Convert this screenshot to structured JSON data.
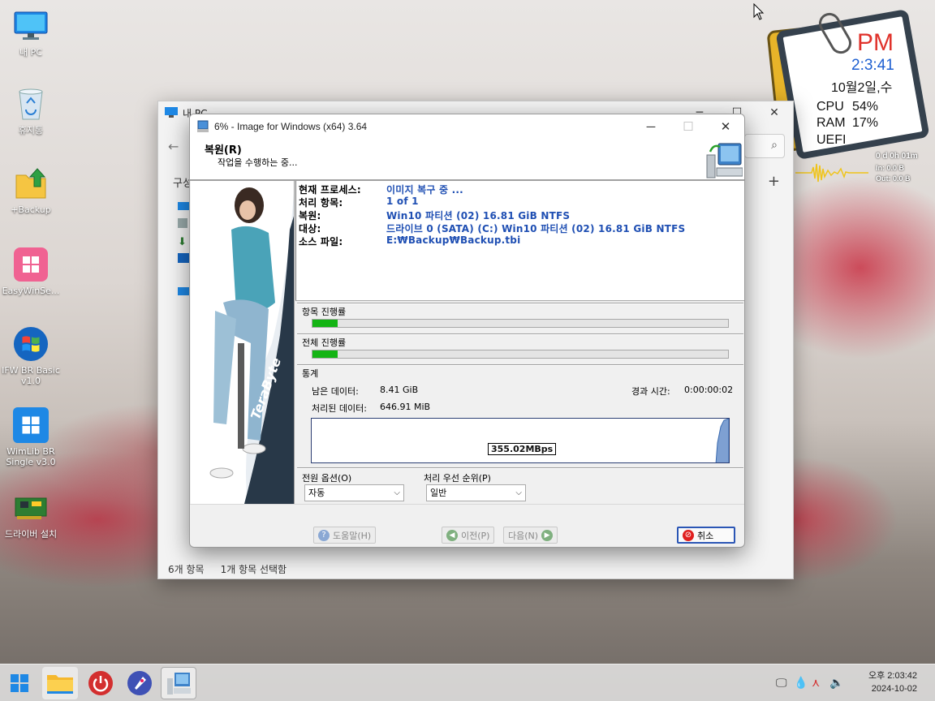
{
  "desktop": {
    "icons": [
      {
        "label": "내 PC",
        "icon": "monitor-icon"
      },
      {
        "label": "휴지통",
        "icon": "recycle-bin-icon"
      },
      {
        "label": "+Backup",
        "icon": "folder-upload-icon"
      },
      {
        "label": "EasyWinSe...",
        "icon": "windows-tile-icon"
      },
      {
        "label": "IFW BR Basic v1.0",
        "icon": "windows-logo-icon"
      },
      {
        "label": "WimLib BR Single v3.0",
        "icon": "windows-tile-icon"
      },
      {
        "label": "드라이버 설치",
        "icon": "circuit-board-icon"
      }
    ]
  },
  "clock_widget": {
    "ampm": "PM",
    "time": "2:3:41",
    "date": "10월2일,수",
    "cpu_label": "CPU",
    "cpu_value": "54%",
    "ram_label": "RAM",
    "ram_value": "17%",
    "boot": "UEFI",
    "net_uptime": "0 d 0h 01m",
    "net_in": "In: 0.0 B",
    "net_out": "Out: 0.0 B"
  },
  "explorer": {
    "title": "내 PC",
    "toolbar_label": "구성",
    "status_items": "6개 항목",
    "status_selected": "1개 항목 선택함"
  },
  "ifw": {
    "title": "6% - Image for Windows (x64) 3.64",
    "progress_percent": 6,
    "header_title": "복원(R)",
    "header_subtitle": "작업을 수행하는 중...",
    "info": [
      {
        "key": "현재 프로세스:",
        "value": "이미지 복구 중 ..."
      },
      {
        "key": "처리 항목:",
        "value": "1 of 1"
      },
      {
        "key": "복원:",
        "value": "Win10 파티션 (02) 16.81 GiB NTFS"
      },
      {
        "key": "대상:",
        "value": "드라이브 0 (SATA) (C:) Win10 파티션 (02) 16.81 GiB NTFS"
      },
      {
        "key": "소스 파일:",
        "value": "E:₩Backup₩Backup.tbi"
      }
    ],
    "item_progress_label": "항목 진행률",
    "item_progress": 0.06,
    "total_progress_label": "전체 진행률",
    "total_progress": 0.06,
    "stats_label": "통계",
    "remaining_label": "남은 데이터:",
    "remaining_value": "8.41 GiB",
    "elapsed_label": "경과 시간:",
    "elapsed_value": "0:00:00:02",
    "processed_label": "처리된 데이터:",
    "processed_value": "646.91 MiB",
    "speed": "355.02MBps",
    "power_label": "전원 옵션(O)",
    "power_value": "자동",
    "priority_label": "처리 우선 순위(P)",
    "priority_value": "일반",
    "help_button": "도움말(H)",
    "prev_button": "이전(P)",
    "next_button": "다음(N)",
    "cancel_button": "취소",
    "brand": "TeraByte"
  },
  "taskbar": {
    "items": [
      "start-icon",
      "file-explorer-icon",
      "power-icon",
      "rocket-icon",
      "image-for-windows-icon"
    ],
    "tray_time": "오후 2:03:42",
    "tray_date": "2024-10-02"
  },
  "colors": {
    "info_value": "#1f4fb3",
    "progress_fill": "#14b414",
    "clock_ampm": "#e0322b",
    "clock_time": "#1d5fd1"
  }
}
